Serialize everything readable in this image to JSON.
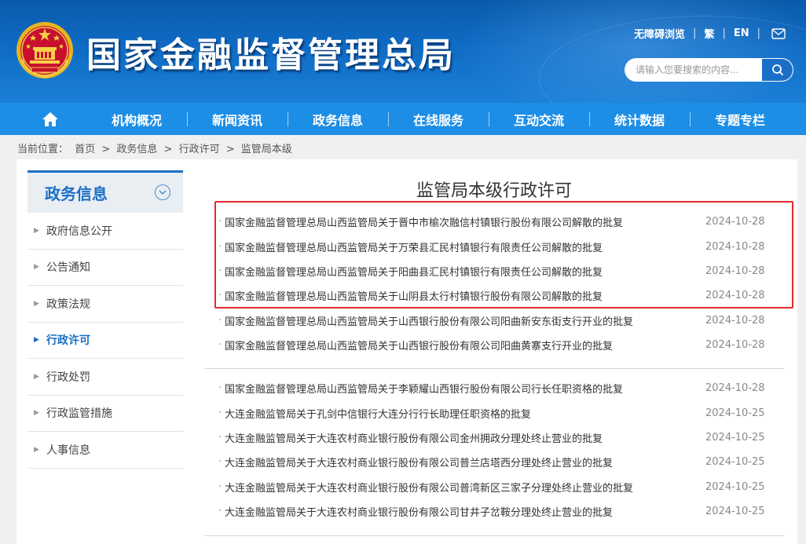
{
  "header": {
    "site_title": "国家金融监督管理总局",
    "top_links": [
      "无障碍浏览",
      "繁",
      "EN"
    ],
    "search_placeholder": "请输入您要搜索的内容..."
  },
  "nav": {
    "items": [
      "机构概况",
      "新闻资讯",
      "政务信息",
      "在线服务",
      "互动交流",
      "统计数据",
      "专题专栏"
    ]
  },
  "breadcrumb": {
    "prefix": "当前位置：",
    "path": [
      "首页",
      "政务信息",
      "行政许可",
      "监管局本级"
    ],
    "separator": ">"
  },
  "sidebar": {
    "title": "政务信息",
    "items": [
      "政府信息公开",
      "公告通知",
      "政策法规",
      "行政许可",
      "行政处罚",
      "行政监管措施",
      "人事信息"
    ],
    "active_index": 3
  },
  "content": {
    "title": "监管局本级行政许可",
    "groups": [
      [
        {
          "title": "国家金融监督管理总局山西监管局关于晋中市榆次融信村镇银行股份有限公司解散的批复",
          "date": "2024-10-28"
        },
        {
          "title": "国家金融监督管理总局山西监管局关于万荣县汇民村镇银行有限责任公司解散的批复",
          "date": "2024-10-28"
        },
        {
          "title": "国家金融监督管理总局山西监管局关于阳曲县汇民村镇银行有限责任公司解散的批复",
          "date": "2024-10-28"
        },
        {
          "title": "国家金融监督管理总局山西监管局关于山阴县太行村镇银行股份有限公司解散的批复",
          "date": "2024-10-28"
        },
        {
          "title": "国家金融监督管理总局山西监管局关于山西银行股份有限公司阳曲新安东街支行开业的批复",
          "date": "2024-10-28"
        },
        {
          "title": "国家金融监督管理总局山西监管局关于山西银行股份有限公司阳曲黄寨支行开业的批复",
          "date": "2024-10-28"
        }
      ],
      [
        {
          "title": "国家金融监督管理总局山西监管局关于李颖耀山西银行股份有限公司行长任职资格的批复",
          "date": "2024-10-28"
        },
        {
          "title": "大连金融监管局关于孔剑中信银行大连分行行长助理任职资格的批复",
          "date": "2024-10-25"
        },
        {
          "title": "大连金融监管局关于大连农村商业银行股份有限公司金州拥政分理处终止营业的批复",
          "date": "2024-10-25"
        },
        {
          "title": "大连金融监管局关于大连农村商业银行股份有限公司普兰店塔西分理处终止营业的批复",
          "date": "2024-10-25"
        },
        {
          "title": "大连金融监管局关于大连农村商业银行股份有限公司普湾新区三家子分理处终止营业的批复",
          "date": "2024-10-25"
        },
        {
          "title": "大连金融监管局关于大连农村商业银行股份有限公司甘井子岔鞍分理处终止营业的批复",
          "date": "2024-10-25"
        }
      ]
    ]
  },
  "colors": {
    "header_blue": "#0f6bc4",
    "nav_blue": "#1d8ee6",
    "accent": "#1b70c4",
    "highlight_red": "#e22a2a"
  }
}
